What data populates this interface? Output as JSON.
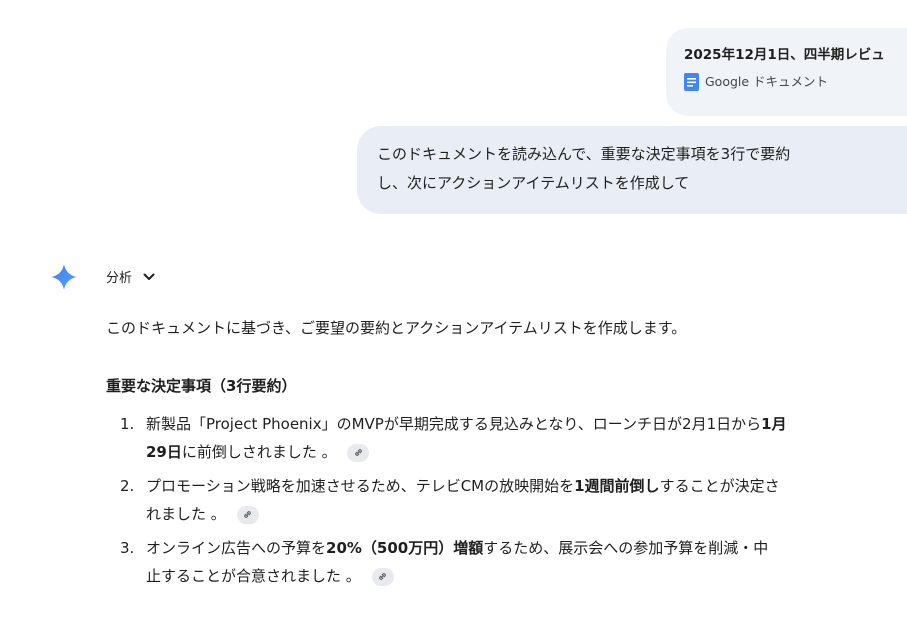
{
  "attachment": {
    "title": "2025年12月1日、四半期レビュ",
    "type_label": "Google ドキュメント"
  },
  "user_message": {
    "line1": "このドキュメントを読み込んで、重要な決定事項を3行で要約",
    "line2": "し、次にアクションアイテムリストを作成して"
  },
  "response": {
    "analysis_label": "分析",
    "intro": "このドキュメントに基づき、ご要望の要約とアクションアイテムリストを作成します。",
    "heading": "重要な決定事項（3行要約）",
    "items": [
      {
        "num": "1.",
        "line1_a": "新製品「Project Phoenix」のMVPが早期完成する見込みとなり、ローンチ日が2月1日から",
        "line1_bold": "1月",
        "line2_bold": "29日",
        "line2_b": "に前倒しされました 。"
      },
      {
        "num": "2.",
        "line1_a": "プロモーション戦略を加速させるため、テレビCMの放映開始を",
        "line1_bold": "1週間前倒し",
        "line1_b": "することが決定さ",
        "line2_b": "れました 。"
      },
      {
        "num": "3.",
        "line1_a": "オンライン広告への予算を",
        "line1_bold": "20%（500万円）増額",
        "line1_b": "するため、展示会への参加予算を削減・中",
        "line2_b": "止することが合意されました 。"
      }
    ]
  },
  "colors": {
    "attachment_bg": "#f0f4f9",
    "user_bubble_bg": "#e9eef6",
    "docs_icon_blue": "#4285f4",
    "gemini_accent": "#4c8df6"
  },
  "icons": {
    "doc": "google-docs-icon",
    "gemini": "gemini-sparkle-icon",
    "chevron": "chevron-down-icon",
    "citation": "link-icon"
  }
}
